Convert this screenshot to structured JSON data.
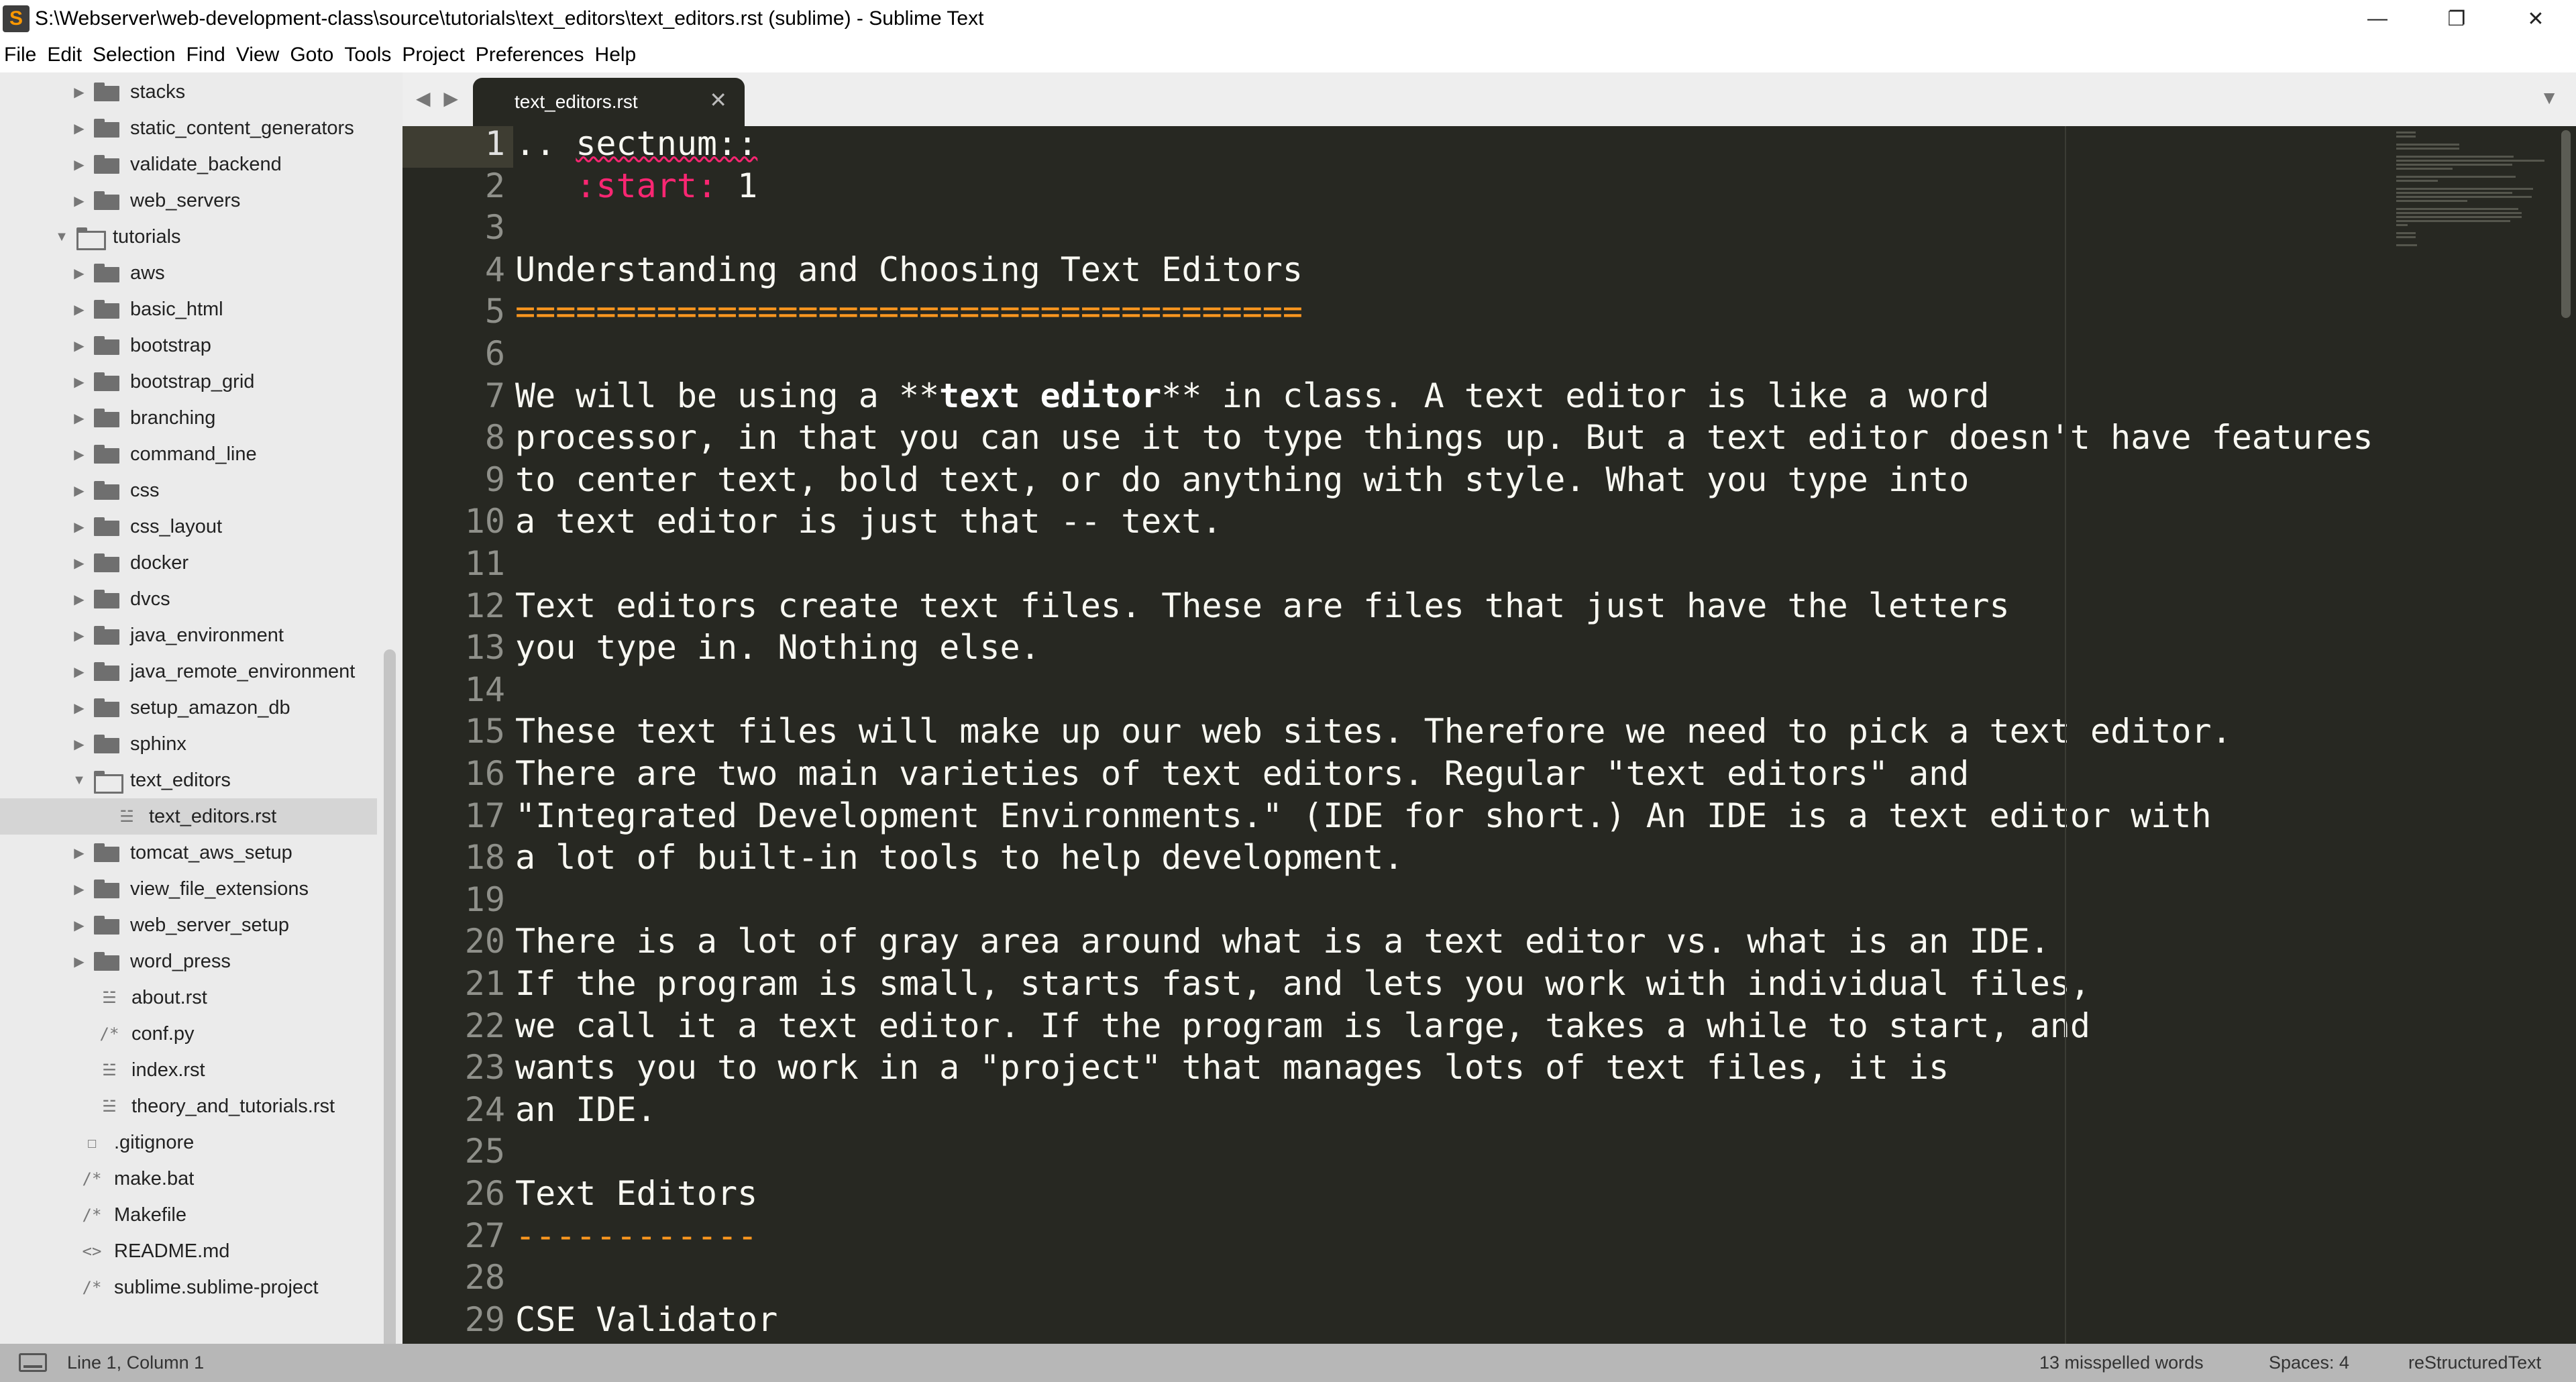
{
  "window": {
    "title": "S:\\Webserver\\web-development-class\\source\\tutorials\\text_editors\\text_editors.rst (sublime) - Sublime Text",
    "app_icon_glyph": "S",
    "minimize_glyph": "—",
    "maximize_glyph": "❐",
    "close_glyph": "✕"
  },
  "menu": [
    "File",
    "Edit",
    "Selection",
    "Find",
    "View",
    "Goto",
    "Tools",
    "Project",
    "Preferences",
    "Help"
  ],
  "sidebar": {
    "items": [
      {
        "label": "stacks",
        "type": "folder",
        "depth": 1,
        "expanded": false
      },
      {
        "label": "static_content_generators",
        "type": "folder",
        "depth": 1,
        "expanded": false
      },
      {
        "label": "validate_backend",
        "type": "folder",
        "depth": 1,
        "expanded": false
      },
      {
        "label": "web_servers",
        "type": "folder",
        "depth": 1,
        "expanded": false
      },
      {
        "label": "tutorials",
        "type": "folder",
        "depth": 0,
        "expanded": true
      },
      {
        "label": "aws",
        "type": "folder",
        "depth": 1,
        "expanded": false
      },
      {
        "label": "basic_html",
        "type": "folder",
        "depth": 1,
        "expanded": false
      },
      {
        "label": "bootstrap",
        "type": "folder",
        "depth": 1,
        "expanded": false
      },
      {
        "label": "bootstrap_grid",
        "type": "folder",
        "depth": 1,
        "expanded": false
      },
      {
        "label": "branching",
        "type": "folder",
        "depth": 1,
        "expanded": false
      },
      {
        "label": "command_line",
        "type": "folder",
        "depth": 1,
        "expanded": false
      },
      {
        "label": "css",
        "type": "folder",
        "depth": 1,
        "expanded": false
      },
      {
        "label": "css_layout",
        "type": "folder",
        "depth": 1,
        "expanded": false
      },
      {
        "label": "docker",
        "type": "folder",
        "depth": 1,
        "expanded": false
      },
      {
        "label": "dvcs",
        "type": "folder",
        "depth": 1,
        "expanded": false
      },
      {
        "label": "java_environment",
        "type": "folder",
        "depth": 1,
        "expanded": false
      },
      {
        "label": "java_remote_environment",
        "type": "folder",
        "depth": 1,
        "expanded": false
      },
      {
        "label": "setup_amazon_db",
        "type": "folder",
        "depth": 1,
        "expanded": false
      },
      {
        "label": "sphinx",
        "type": "folder",
        "depth": 1,
        "expanded": false
      },
      {
        "label": "text_editors",
        "type": "folder",
        "depth": 1,
        "expanded": true
      },
      {
        "label": "text_editors.rst",
        "type": "file",
        "icon": "☱",
        "depth": 2,
        "selected": true
      },
      {
        "label": "tomcat_aws_setup",
        "type": "folder",
        "depth": 1,
        "expanded": false
      },
      {
        "label": "view_file_extensions",
        "type": "folder",
        "depth": 1,
        "expanded": false
      },
      {
        "label": "web_server_setup",
        "type": "folder",
        "depth": 1,
        "expanded": false
      },
      {
        "label": "word_press",
        "type": "folder",
        "depth": 1,
        "expanded": false
      },
      {
        "label": "about.rst",
        "type": "file",
        "icon": "☱",
        "depth": 1
      },
      {
        "label": "conf.py",
        "type": "file",
        "icon": "/*",
        "depth": 1
      },
      {
        "label": "index.rst",
        "type": "file",
        "icon": "☱",
        "depth": 1
      },
      {
        "label": "theory_and_tutorials.rst",
        "type": "file",
        "icon": "☱",
        "depth": 1
      },
      {
        "label": ".gitignore",
        "type": "file",
        "icon": "☐",
        "depth": 0
      },
      {
        "label": "make.bat",
        "type": "file",
        "icon": "/*",
        "depth": 0
      },
      {
        "label": "Makefile",
        "type": "file",
        "icon": "/*",
        "depth": 0
      },
      {
        "label": "README.md",
        "type": "file",
        "icon": "<>",
        "depth": 0
      },
      {
        "label": "sublime.sublime-project",
        "type": "file",
        "icon": "/*",
        "depth": 0
      }
    ]
  },
  "tabs": {
    "nav_arrows": "◀ ▶",
    "active_label": "text_editors.rst",
    "close_glyph": "✕",
    "dropdown_glyph": "▼"
  },
  "editor": {
    "current_line": 1,
    "lines": [
      {
        "n": "1",
        "spans": [
          {
            "t": ".. ",
            "c": "white"
          },
          {
            "t": "sectnum::",
            "c": "white",
            "squiggle": true
          }
        ]
      },
      {
        "n": "2",
        "spans": [
          {
            "t": "   ",
            "c": "white"
          },
          {
            "t": ":start:",
            "c": "pink"
          },
          {
            "t": " 1",
            "c": "white"
          }
        ]
      },
      {
        "n": "3",
        "spans": []
      },
      {
        "n": "4",
        "spans": [
          {
            "t": "Understanding and Choosing Text Editors",
            "c": "white"
          }
        ]
      },
      {
        "n": "5",
        "spans": [
          {
            "t": "=======================================",
            "c": "orange"
          }
        ]
      },
      {
        "n": "6",
        "spans": []
      },
      {
        "n": "7",
        "spans": [
          {
            "t": "We will be using a **",
            "c": "white"
          },
          {
            "t": "text editor",
            "c": "bold"
          },
          {
            "t": "** in class. A text editor is like a word",
            "c": "white"
          }
        ]
      },
      {
        "n": "8",
        "spans": [
          {
            "t": "processor, in that you can use it to type things up. But a text editor doesn't have features",
            "c": "white"
          }
        ]
      },
      {
        "n": "9",
        "spans": [
          {
            "t": "to center text, bold text, or do anything with style. What you type into",
            "c": "white"
          }
        ]
      },
      {
        "n": "10",
        "spans": [
          {
            "t": "a text editor is just that -- text.",
            "c": "white"
          }
        ]
      },
      {
        "n": "11",
        "spans": []
      },
      {
        "n": "12",
        "spans": [
          {
            "t": "Text editors create text files. These are files that just have the letters",
            "c": "white"
          }
        ]
      },
      {
        "n": "13",
        "spans": [
          {
            "t": "you type in. Nothing else.",
            "c": "white"
          }
        ]
      },
      {
        "n": "14",
        "spans": []
      },
      {
        "n": "15",
        "spans": [
          {
            "t": "These text files will make up our web sites. Therefore we need to pick a text editor.",
            "c": "white"
          }
        ]
      },
      {
        "n": "16",
        "spans": [
          {
            "t": "There are two main varieties of text editors. Regular \"text editors\" and",
            "c": "white"
          }
        ]
      },
      {
        "n": "17",
        "spans": [
          {
            "t": "\"Integrated Development Environments.\" (IDE for short.) An IDE is a text editor with",
            "c": "white"
          }
        ]
      },
      {
        "n": "18",
        "spans": [
          {
            "t": "a lot of built-in tools to help development.",
            "c": "white"
          }
        ]
      },
      {
        "n": "19",
        "spans": []
      },
      {
        "n": "20",
        "spans": [
          {
            "t": "There is a lot of gray area around what is a text editor vs. what is an IDE.",
            "c": "white"
          }
        ]
      },
      {
        "n": "21",
        "spans": [
          {
            "t": "If the program is small, starts fast, and lets you work with individual files,",
            "c": "white"
          }
        ]
      },
      {
        "n": "22",
        "spans": [
          {
            "t": "we call it a text editor. If the program is large, takes a while to start, and",
            "c": "white"
          }
        ]
      },
      {
        "n": "23",
        "spans": [
          {
            "t": "wants you to work in a \"project\" that manages lots of text files, it is",
            "c": "white"
          }
        ]
      },
      {
        "n": "24",
        "spans": [
          {
            "t": "an IDE.",
            "c": "white"
          }
        ]
      },
      {
        "n": "25",
        "spans": []
      },
      {
        "n": "26",
        "spans": [
          {
            "t": "Text Editors",
            "c": "white"
          }
        ]
      },
      {
        "n": "27",
        "spans": [
          {
            "t": "------------",
            "c": "orange"
          }
        ]
      },
      {
        "n": "28",
        "spans": []
      },
      {
        "n": "29",
        "spans": [
          {
            "t": "CSE Validator",
            "c": "white"
          }
        ]
      }
    ]
  },
  "status": {
    "position": "Line 1, Column 1",
    "misspelled": "13 misspelled words",
    "indentation": "Spaces: 4",
    "syntax": "reStructuredText"
  },
  "colors": {
    "editor_bg": "#272822",
    "text": "#f8f8f2",
    "keyword_pink": "#f92672",
    "heading_orange": "#fd971f",
    "sidebar_bg": "#ebebeb",
    "status_bg": "#b7b7b7"
  }
}
